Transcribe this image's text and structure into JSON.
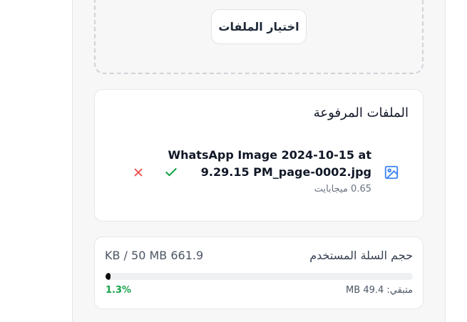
{
  "upload": {
    "choose_button_label": "اختيار الملفات"
  },
  "uploaded_files": {
    "title": "الملفات المرفوعة",
    "items": [
      {
        "name": "WhatsApp Image 2024-10-15 at 9.29.15 PM_page-0002.jpg",
        "size": "0.65 ميجابايت",
        "status_icon": "check-icon",
        "type_icon": "image-icon"
      }
    ]
  },
  "cart": {
    "label": "حجم السلة المستخدم",
    "usage": "661.9 KB / 50 MB",
    "percent": "1.3%",
    "fraction": 0.013,
    "remaining": "متبقي: 49.4 MB"
  },
  "colors": {
    "accent_blue": "#3b82f6",
    "success_green": "#16a34a",
    "danger_red": "#ef4444"
  }
}
